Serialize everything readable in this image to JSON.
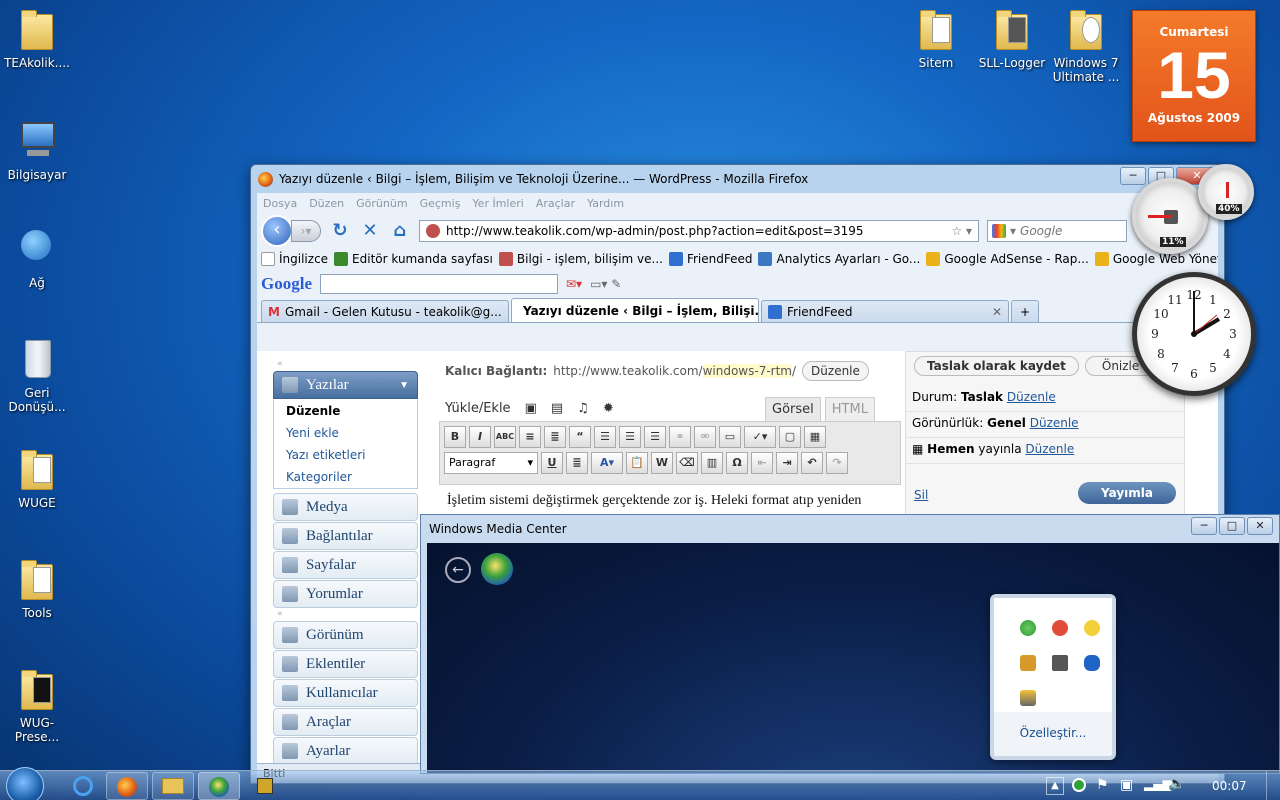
{
  "desktop": {
    "icons_left": [
      {
        "label": "TEAkolik....",
        "type": "user-folder-icon"
      },
      {
        "label": "Bilgisayar",
        "type": "computer-icon"
      },
      {
        "label": "Ağ",
        "type": "network-icon"
      },
      {
        "label": "Geri\nDonüşü...",
        "type": "recycle-bin-icon"
      },
      {
        "label": "WUGE",
        "type": "folder-icon"
      },
      {
        "label": "Tools",
        "type": "folder-icon"
      },
      {
        "label": "WUG-Prese...",
        "type": "folder-icon"
      }
    ],
    "icons_top": [
      {
        "label": "Sitem",
        "type": "folder-icon"
      },
      {
        "label": "SLL-Logger",
        "type": "folder-icon"
      },
      {
        "label": "Windows 7\nUltimate ...",
        "type": "folder-icon"
      }
    ]
  },
  "gadgets": {
    "calendar": {
      "weekday": "Cumartesi",
      "day": "15",
      "month_year": "Ağustos 2009"
    },
    "cpu_meter": {
      "cpu": "11%",
      "memory": "40%"
    }
  },
  "firefox": {
    "title": "Yazıyı düzenle ‹ Bilgi – İşlem, Bilişim ve Teknoloji Üzerine... — WordPress - Mozilla Firefox",
    "menu": [
      "Dosya",
      "Düzen",
      "Görünüm",
      "Geçmiş",
      "Yer İmleri",
      "Araçlar",
      "Yardım"
    ],
    "url": "http://www.teakolik.com/wp-admin/post.php?action=edit&post=3195",
    "search_placeholder": "Google",
    "bookmarks": [
      {
        "label": "İngilizce",
        "color": "#ffffff"
      },
      {
        "label": "Editör kumanda sayfası",
        "color": "#3a8a2c"
      },
      {
        "label": "Bilgi - işlem, bilişim ve...",
        "color": "#c0504d"
      },
      {
        "label": "FriendFeed",
        "color": "#2f6fd0"
      },
      {
        "label": "Analytics Ayarları - Go...",
        "color": "#3b78c2"
      },
      {
        "label": "Google AdSense - Rap...",
        "color": "#e8b218"
      },
      {
        "label": "Google Web Yöneticisi...",
        "color": "#e8b218"
      }
    ],
    "bookmarks_more": "»",
    "google_toolbar": {
      "logo": "Google"
    },
    "tabs": [
      {
        "label": "Gmail - Gelen Kutusu - teakolik@g...",
        "active": false
      },
      {
        "label": "Yazıyı düzenle ‹ Bilgi – İşlem, Bilişi...",
        "active": true
      },
      {
        "label": "FriendFeed",
        "active": false
      }
    ],
    "status": "Bitti"
  },
  "wp": {
    "menu": {
      "posts": "Yazılar",
      "posts_sub": [
        "Düzenle",
        "Yeni ekle",
        "Yazı etiketleri",
        "Kategoriler"
      ],
      "group1": [
        "Medya",
        "Bağlantılar",
        "Sayfalar",
        "Yorumlar"
      ],
      "group2": [
        "Görünüm",
        "Eklentiler",
        "Kullanıcılar",
        "Araçlar",
        "Ayarlar"
      ]
    },
    "permalink": {
      "label": "Kalıcı Bağlantı:",
      "base": "http://www.teakolik.com/",
      "slug": "windows-7-rtm",
      "trail": "/",
      "edit": "Düzenle"
    },
    "upload_label": "Yükle/Ekle",
    "mode_tabs": {
      "visual": "Görsel",
      "html": "HTML"
    },
    "format_select": "Paragraf",
    "content": "İşletim sistemi değiştirmek gerçektende zor iş. Heleki format atıp yeniden kurma apayrı.  Heleki bizim gibi bilgisayar işleriyle uğraşan kişilerin en",
    "publish": {
      "save_draft": "Taslak olarak kaydet",
      "preview": "Önizle",
      "status_label": "Durum:",
      "status_value": "Taslak",
      "visibility_label": "Görünürlük:",
      "visibility_value": "Genel",
      "schedule_value": "Hemen",
      "schedule_label": "yayınla",
      "edit": "Düzenle",
      "delete": "Sil",
      "publish_btn": "Yayımla"
    }
  },
  "media_center": {
    "title": "Windows Media Center"
  },
  "tray_popup": {
    "customize": "Özelleştir..."
  },
  "taskbar": {
    "time": "00:07"
  }
}
